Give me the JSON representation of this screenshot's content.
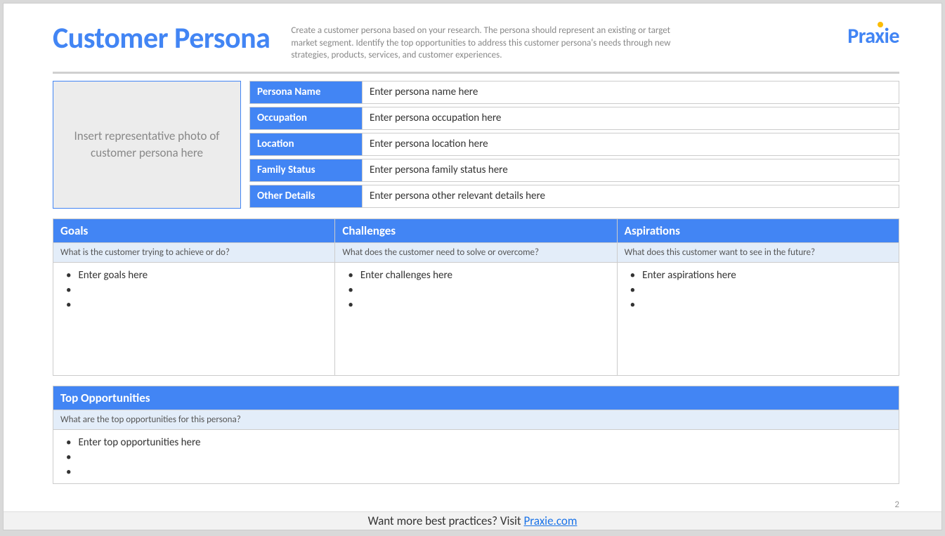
{
  "header": {
    "title": "Customer Persona",
    "description": "Create a customer persona based on your research. The persona should represent an existing or target market segment. Identify the top opportunities to address this customer persona's needs through new strategies, products, services, and customer experiences.",
    "logo_text": "Praxie"
  },
  "photo_placeholder": "Insert representative photo of customer persona here",
  "fields": {
    "name_label": "Persona Name",
    "name_value": "Enter persona name here",
    "occupation_label": "Occupation",
    "occupation_value": "Enter persona occupation here",
    "location_label": "Location",
    "location_value": "Enter persona location here",
    "family_label": "Family Status",
    "family_value": "Enter persona family status here",
    "other_label": "Other Details",
    "other_value": "Enter persona other relevant details here"
  },
  "columns": {
    "goals": {
      "header": "Goals",
      "sub": "What is the customer trying to achieve or do?",
      "item": "Enter goals here"
    },
    "challenges": {
      "header": "Challenges",
      "sub": "What does the customer need to solve or overcome?",
      "item": "Enter challenges here"
    },
    "aspirations": {
      "header": "Aspirations",
      "sub": "What does this customer want to see in the future?",
      "item": "Enter aspirations here"
    }
  },
  "opportunities": {
    "header": "Top Opportunities",
    "sub": "What are the top opportunities for this persona?",
    "item": "Enter top opportunities here"
  },
  "page_number": "2",
  "footer": {
    "text": "Want more best practices? Visit ",
    "link_text": "Praxie.com"
  }
}
